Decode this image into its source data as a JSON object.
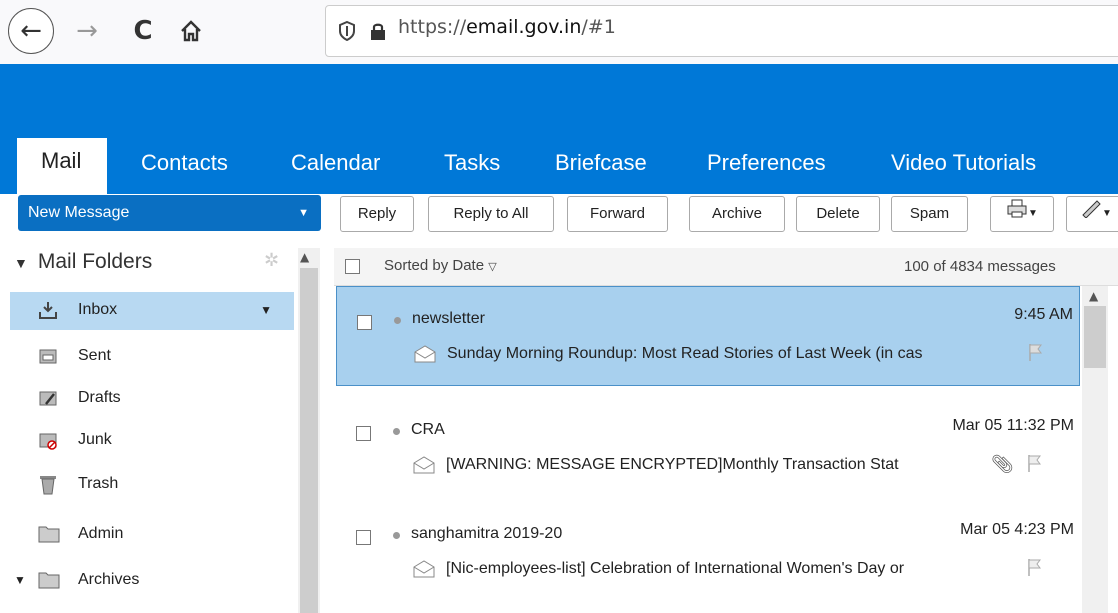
{
  "browser": {
    "url_prefix": "https://",
    "url_domain": "email.gov.in",
    "url_suffix": "/#1",
    "icons": [
      "back-icon",
      "forward-icon",
      "reload-icon",
      "home-icon",
      "shield-icon",
      "lock-icon"
    ]
  },
  "nav": {
    "tabs": [
      {
        "label": "Mail",
        "active": true
      },
      {
        "label": "Contacts"
      },
      {
        "label": "Calendar"
      },
      {
        "label": "Tasks"
      },
      {
        "label": "Briefcase"
      },
      {
        "label": "Preferences"
      },
      {
        "label": "Video Tutorials"
      }
    ]
  },
  "toolbar": {
    "new_message": "New Message",
    "reply": "Reply",
    "reply_all": "Reply to All",
    "forward": "Forward",
    "archive": "Archive",
    "delete": "Delete",
    "spam": "Spam",
    "print_icon": "print-icon",
    "tag_icon": "tag-icon"
  },
  "sidebar": {
    "header": "Mail Folders",
    "folders": [
      {
        "label": "Inbox",
        "icon": "inbox-icon",
        "selected": true
      },
      {
        "label": "Sent",
        "icon": "sent-icon"
      },
      {
        "label": "Drafts",
        "icon": "drafts-icon"
      },
      {
        "label": "Junk",
        "icon": "junk-icon"
      },
      {
        "label": "Trash",
        "icon": "trash-icon"
      },
      {
        "label": "Admin",
        "icon": "folder-icon"
      },
      {
        "label": "Archives",
        "icon": "folder-icon"
      }
    ]
  },
  "list": {
    "sort_label": "Sorted by Date",
    "count": "100 of 4834 messages",
    "messages": [
      {
        "sender": "newsletter",
        "time": "9:45 AM",
        "subject": "Sunday Morning Roundup: Most Read Stories of Last Week (in cas",
        "attachment": false,
        "selected": true
      },
      {
        "sender": "CRA",
        "time": "Mar 05 11:32 PM",
        "subject": "[WARNING: MESSAGE ENCRYPTED]Monthly Transaction Stat",
        "attachment": true,
        "selected": false
      },
      {
        "sender": "sanghamitra 2019-20",
        "time": "Mar 05 4:23 PM",
        "subject": "[Nic-employees-list] Celebration of International Women's Day or",
        "attachment": false,
        "selected": false
      }
    ]
  },
  "colors": {
    "banner": "#0078d7",
    "new_message_bg": "#0a6fc2",
    "selected_row": "#a8d0ee",
    "selected_folder": "#b8d9f2"
  }
}
